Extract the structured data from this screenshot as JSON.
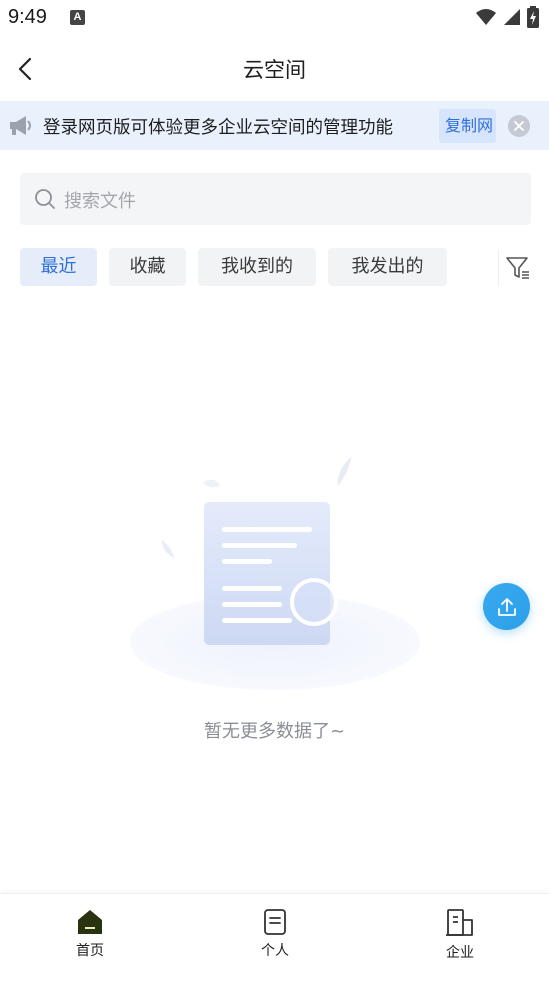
{
  "status_bar": {
    "time": "9:49",
    "notification_badge": "A",
    "icons": [
      "wifi-icon",
      "signal-icon",
      "battery-charging-icon"
    ]
  },
  "header": {
    "title": "云空间",
    "back_icon": "chevron-left-icon"
  },
  "notice": {
    "icon": "megaphone-icon",
    "text": "登录网页版可体验更多企业云空间的管理功能",
    "copy_label": "复制网",
    "close_icon": "close-circle-icon"
  },
  "search": {
    "placeholder": "搜索文件",
    "icon": "search-icon"
  },
  "tabs": [
    {
      "label": "最近",
      "active": true
    },
    {
      "label": "收藏",
      "active": false
    },
    {
      "label": "我收到的",
      "active": false
    },
    {
      "label": "我发出的",
      "active": false
    }
  ],
  "filter_icon": "filter-icon",
  "empty_state": {
    "illustration": "empty-document-illustration",
    "text": "暂无更多数据了~"
  },
  "upload_icon": "upload-icon",
  "bottom_nav": [
    {
      "label": "首页",
      "icon": "home-icon",
      "active": true
    },
    {
      "label": "个人",
      "icon": "document-icon",
      "active": false
    },
    {
      "label": "企业",
      "icon": "building-icon",
      "active": false
    }
  ],
  "colors": {
    "accent": "#2f6fd8",
    "notice_bg": "#e9f1fd",
    "upload_button": "#2aa0e8",
    "home_icon": "#2a3310"
  }
}
